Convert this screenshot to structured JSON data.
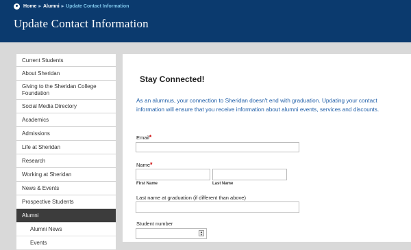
{
  "breadcrumb": {
    "home": "Home",
    "sep1": "▸",
    "alumni": "Alumni",
    "sep2": "▸",
    "current": "Update Contact Information"
  },
  "page": {
    "title": "Update Contact Information"
  },
  "sidebar": {
    "items": [
      {
        "label": "Current Students"
      },
      {
        "label": "About Sheridan"
      },
      {
        "label": "Giving to the Sheridan College Foundation"
      },
      {
        "label": "Social Media Directory"
      },
      {
        "label": "Academics"
      },
      {
        "label": "Admissions"
      },
      {
        "label": "Life at Sheridan"
      },
      {
        "label": "Research"
      },
      {
        "label": "Working at Sheridan"
      },
      {
        "label": "News & Events"
      },
      {
        "label": "Prospective Students"
      },
      {
        "label": "Alumni"
      }
    ],
    "subitems": [
      {
        "label": "Alumni News"
      },
      {
        "label": "Events"
      }
    ]
  },
  "main": {
    "heading": "Stay Connected!",
    "intro": "As an alumnus, your connection to Sheridan doesn't end with graduation. Updating your contact information will ensure that you receive information about alumni events, services and discounts.",
    "form": {
      "email_label": "Email",
      "name_label": "Name",
      "required_marker": "*",
      "first_name_label": "First Name",
      "last_name_label": "Last Name",
      "grad_name_label": "Last name at graduation (if different than above)",
      "student_number_label": "Student number"
    }
  }
}
